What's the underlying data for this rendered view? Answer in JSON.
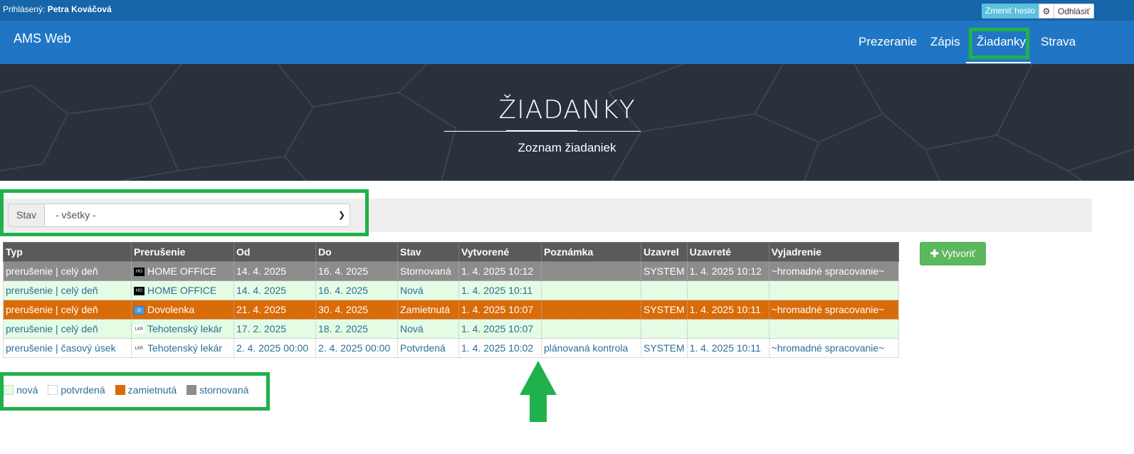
{
  "login": {
    "prefix": "Prihlásený:",
    "user": "Petra Kováčová",
    "change_password": "Zmeniť heslo",
    "settings_icon": "gear-icon",
    "logout": "Odhlásiť"
  },
  "navbar": {
    "brand": "AMS Web",
    "items": [
      {
        "label": "Prezeranie"
      },
      {
        "label": "Zápis"
      },
      {
        "label": "Žiadanky",
        "active": true
      },
      {
        "label": "Strava"
      }
    ]
  },
  "hero": {
    "title": "ŽIADANKY",
    "subtitle": "Zoznam žiadaniek"
  },
  "filter": {
    "label": "Stav",
    "selected": "- všetky -"
  },
  "table": {
    "headers": [
      "Typ",
      "Prerušenie",
      "Od",
      "Do",
      "Stav",
      "Vytvorené",
      "Poznámka",
      "Uzavrel",
      "Uzavreté",
      "Vyjadrenie"
    ],
    "rows": [
      {
        "status": "storno",
        "typ": "prerušenie | celý deň",
        "icon": "HO",
        "prerusenie": "HOME OFFICE",
        "od": "14. 4. 2025",
        "do": "16. 4. 2025",
        "stav": "Stornovaná",
        "vytvorene": "1. 4. 2025 10:12",
        "poznamka": "",
        "uzavrel": "SYSTEM",
        "uzavrete": "1. 4. 2025 10:12",
        "vyjadrenie": "~hromadné spracovanie~"
      },
      {
        "status": "nova",
        "typ": "prerušenie | celý deň",
        "icon": "HO",
        "prerusenie": "HOME OFFICE",
        "od": "14. 4. 2025",
        "do": "16. 4. 2025",
        "stav": "Nová",
        "vytvorene": "1. 4. 2025 10:11",
        "poznamka": "",
        "uzavrel": "",
        "uzavrete": "",
        "vyjadrenie": ""
      },
      {
        "status": "zamietnuta",
        "typ": "prerušenie | celý deň",
        "icon": "D",
        "prerusenie": "Dovolenka",
        "od": "21. 4. 2025",
        "do": "30. 4. 2025",
        "stav": "Zamietnutá",
        "vytvorene": "1. 4. 2025 10:07",
        "poznamka": "",
        "uzavrel": "SYSTEM",
        "uzavrete": "1. 4. 2025 10:11",
        "vyjadrenie": "~hromadné spracovanie~"
      },
      {
        "status": "nova",
        "typ": "prerušenie | celý deň",
        "icon": "LKR",
        "prerusenie": "Tehotenský lekár",
        "od": "17. 2. 2025",
        "do": "18. 2. 2025",
        "stav": "Nová",
        "vytvorene": "1. 4. 2025 10:07",
        "poznamka": "",
        "uzavrel": "",
        "uzavrete": "",
        "vyjadrenie": ""
      },
      {
        "status": "potvrdena",
        "typ": "prerušenie | časový úsek",
        "icon": "LKR",
        "prerusenie": "Tehotenský lekár",
        "od": "2. 4. 2025 00:00",
        "do": "2. 4. 2025 00:00",
        "stav": "Potvrdená",
        "vytvorene": "1. 4. 2025 10:02",
        "poznamka": "plánovaná kontrola",
        "uzavrel": "SYSTEM",
        "uzavrete": "1. 4. 2025 10:11",
        "vyjadrenie": "~hromadné spracovanie~"
      }
    ]
  },
  "create_button": "Vytvoriť",
  "legend": [
    {
      "key": "nova",
      "label": "nová"
    },
    {
      "key": "potvrdena",
      "label": "potvrdená"
    },
    {
      "key": "zamietnuta",
      "label": "zamietnutá"
    },
    {
      "key": "storno",
      "label": "stornovaná"
    }
  ],
  "colors": {
    "navbar": "#2076c4",
    "highlight": "#20b14c",
    "row_nova": "#e4fbe4",
    "row_zamietnuta": "#d96b09",
    "row_storno": "#8c8c8c"
  }
}
